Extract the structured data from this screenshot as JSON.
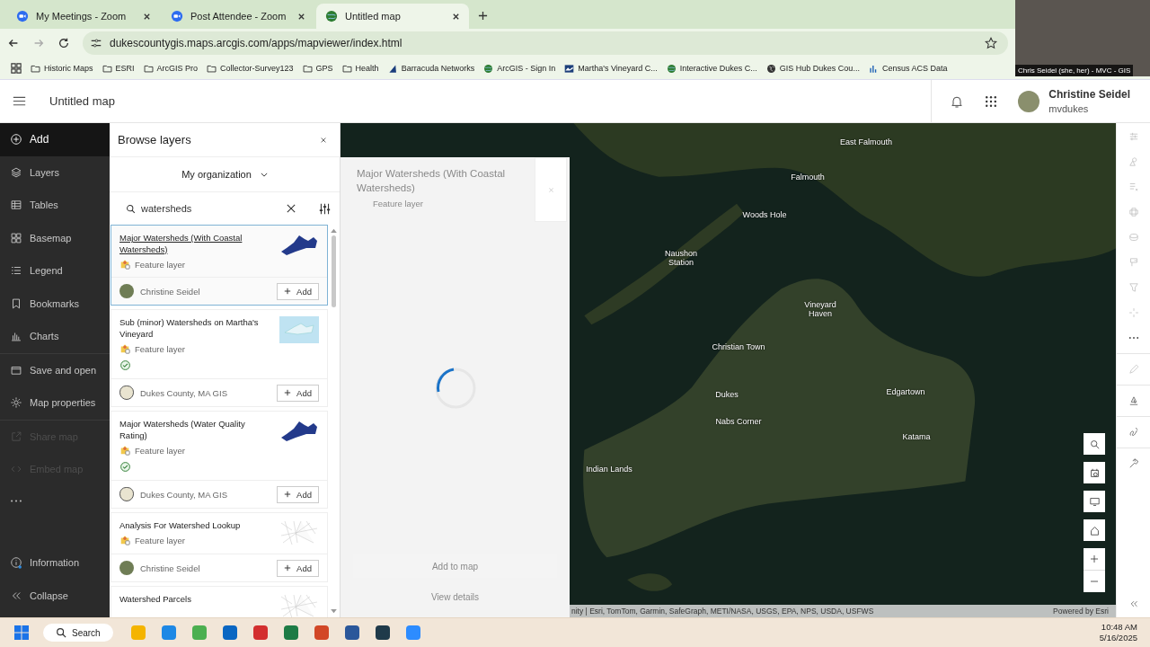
{
  "browser": {
    "tabs": [
      {
        "title": "My Meetings - Zoom",
        "selected": false
      },
      {
        "title": "Post Attendee - Zoom",
        "selected": false
      },
      {
        "title": "Untitled map",
        "selected": true
      }
    ],
    "url": "dukescountygis.maps.arcgis.com/apps/mapviewer/index.html",
    "bookmarks": [
      {
        "label": "Historic Maps",
        "kind": "folder"
      },
      {
        "label": "ESRI",
        "kind": "folder"
      },
      {
        "label": "ArcGIS Pro",
        "kind": "folder"
      },
      {
        "label": "Collector-Survey123",
        "kind": "folder"
      },
      {
        "label": "GPS",
        "kind": "folder"
      },
      {
        "label": "Health",
        "kind": "folder"
      },
      {
        "label": "Barracuda Networks",
        "kind": "fin"
      },
      {
        "label": "ArcGIS - Sign In",
        "kind": "globe"
      },
      {
        "label": "Martha's Vineyard C...",
        "kind": "logo"
      },
      {
        "label": "Interactive Dukes C...",
        "kind": "globe"
      },
      {
        "label": "GIS Hub Dukes Cou...",
        "kind": "world"
      },
      {
        "label": "Census ACS Data",
        "kind": "chart"
      }
    ],
    "video": {
      "caption": "Chris Seidel (she, her) - MVC - GIS"
    }
  },
  "header": {
    "title": "Untitled map",
    "user": {
      "name": "Christine Seidel",
      "username": "mvdukes"
    }
  },
  "nav": {
    "items": [
      {
        "label": "Add",
        "selected": true,
        "disabled": false
      },
      {
        "label": "Layers",
        "selected": false,
        "disabled": false
      },
      {
        "label": "Tables",
        "selected": false,
        "disabled": false
      },
      {
        "label": "Basemap",
        "selected": false,
        "disabled": false
      },
      {
        "label": "Legend",
        "selected": false,
        "disabled": false
      },
      {
        "label": "Bookmarks",
        "selected": false,
        "disabled": false
      },
      {
        "label": "Charts",
        "selected": false,
        "disabled": false
      },
      {
        "label": "Save and open",
        "selected": false,
        "disabled": false
      },
      {
        "label": "Map properties",
        "selected": false,
        "disabled": false
      },
      {
        "label": "Share map",
        "selected": false,
        "disabled": true
      },
      {
        "label": "Embed map",
        "selected": false,
        "disabled": true
      }
    ],
    "bottom": [
      {
        "label": "Information"
      },
      {
        "label": "Collapse"
      }
    ]
  },
  "browse": {
    "title": "Browse layers",
    "scope": "My organization",
    "search": {
      "value": "watersheds"
    },
    "results": [
      {
        "title": "Major Watersheds (With Coastal Watersheds)",
        "type": "Feature layer",
        "added": false,
        "owner": "Christine Seidel",
        "action": "Add",
        "selected": true
      },
      {
        "title": "Sub (minor) Watersheds on Martha's Vineyard",
        "type": "Feature layer",
        "added": true,
        "owner": "Dukes County, MA GIS",
        "action": "Add",
        "selected": false
      },
      {
        "title": "Major Watersheds (Water Quality Rating)",
        "type": "Feature layer",
        "added": true,
        "owner": "Dukes County, MA GIS",
        "action": "Add",
        "selected": false
      },
      {
        "title": "Analysis For Watershed Lookup",
        "type": "Feature layer",
        "added": false,
        "owner": "Christine Seidel",
        "action": "Add",
        "selected": false
      },
      {
        "title": "Watershed Parcels",
        "added": false,
        "selected": false
      }
    ]
  },
  "detail": {
    "title": "Major Watersheds (With Coastal Watersheds)",
    "type": "Feature layer",
    "primary": "Add to map",
    "secondary": "View details"
  },
  "map": {
    "places": [
      "East Falmouth",
      "Falmouth",
      "Woods Hole",
      "Naushon Station",
      "Vineyard Haven",
      "Christian Town",
      "Dukes",
      "Nabs Corner",
      "Edgartown",
      "Katama",
      "Indian Lands"
    ],
    "attribution": "nity | Esri, TomTom, Garmin, SafeGraph, METI/NASA, USGS, EPA, NPS, USDA, USFWS",
    "powered": "Powered by Esri"
  },
  "taskbar": {
    "search": "Search",
    "time": "10:48 AM",
    "date": "5/16/2025"
  }
}
